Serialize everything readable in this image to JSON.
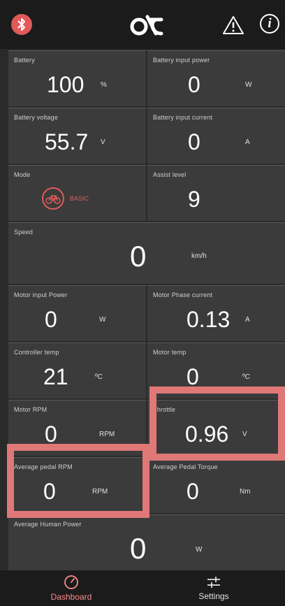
{
  "app": {
    "title": "ot"
  },
  "header": {
    "icons": [
      "bluetooth-icon",
      "warning-icon",
      "info-icon"
    ],
    "info_glyph": "i"
  },
  "tiles": {
    "battery": {
      "label": "Battery",
      "value": "100",
      "unit": "%"
    },
    "battery_power": {
      "label": "Battery input power",
      "value": "0",
      "unit": "W"
    },
    "battery_voltage": {
      "label": "Battery voltage",
      "value": "55.7",
      "unit": "V"
    },
    "battery_current": {
      "label": "Battery input current",
      "value": "0",
      "unit": "A"
    },
    "mode": {
      "label": "Mode",
      "mode_text": "BASIC"
    },
    "assist": {
      "label": "Assist level",
      "value": "9"
    },
    "speed": {
      "label": "Speed",
      "value": "0",
      "unit": "km/h"
    },
    "motor_power": {
      "label": "Motor input Power",
      "value": "0",
      "unit": "W"
    },
    "motor_phase": {
      "label": "Motor Phase current",
      "value": "0.13",
      "unit": "A"
    },
    "controller_temp": {
      "label": "Controller temp",
      "value": "21",
      "unit": "ºC"
    },
    "motor_temp": {
      "label": "Motor temp",
      "value": "0",
      "unit": "ºC"
    },
    "motor_rpm": {
      "label": "Motor RPM",
      "value": "0",
      "unit": "RPM"
    },
    "throttle": {
      "label": "Throttle",
      "value": "0.96",
      "unit": "V"
    },
    "cadence": {
      "label": "Average pedal RPM",
      "value": "0",
      "unit": "RPM"
    },
    "torque": {
      "label": "Average Pedal Torque",
      "value": "0",
      "unit": "Nm"
    },
    "human_power": {
      "label": "Average Human Power",
      "value": "0",
      "unit": "W"
    }
  },
  "nav": {
    "dashboard": "Dashboard",
    "settings": "Settings"
  },
  "colors": {
    "accent": "#e05a5a",
    "highlight": "#e07878",
    "background": "#2a2a2a",
    "tile": "#3b3b3b"
  }
}
